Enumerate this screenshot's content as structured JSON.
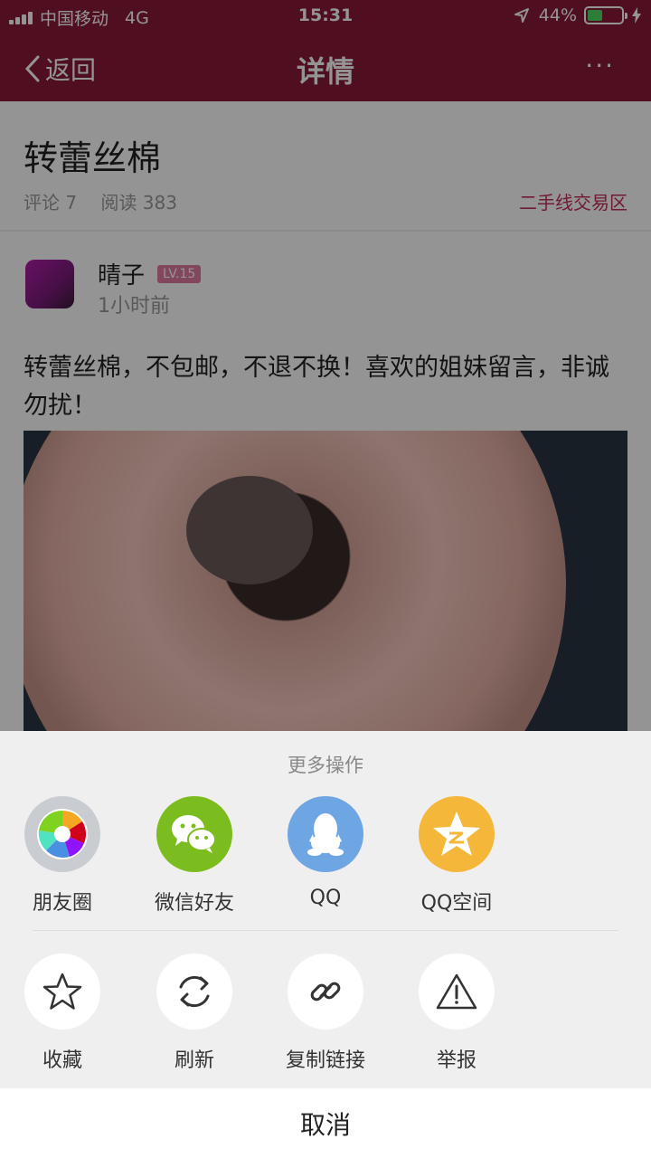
{
  "status_bar": {
    "carrier": "中国移动",
    "network": "4G",
    "time": "15:31",
    "battery": "44%",
    "battery_level": 0.44
  },
  "nav": {
    "back_label": "返回",
    "title": "详情",
    "more_label": "···"
  },
  "post": {
    "title": "转蕾丝棉",
    "comments": "评论 7",
    "reads": "阅读 383",
    "category": "二手线交易区",
    "author": "晴子",
    "level": "LV.15",
    "time_ago": "1小时前",
    "body": "转蕾丝棉，不包邮，不退不换！喜欢的姐妹留言，非诚勿扰！"
  },
  "sheet": {
    "title": "更多操作",
    "share": [
      {
        "label": "朋友圈",
        "icon": "moments-icon",
        "color": "#c9cdd1"
      },
      {
        "label": "微信好友",
        "icon": "wechat-icon",
        "color": "#7bbd1e"
      },
      {
        "label": "QQ",
        "icon": "qq-icon",
        "color": "#6ea6e3"
      },
      {
        "label": "QQ空间",
        "icon": "qzone-icon",
        "color": "#f4b73a"
      }
    ],
    "actions": [
      {
        "label": "收藏",
        "icon": "star-icon"
      },
      {
        "label": "刷新",
        "icon": "refresh-icon"
      },
      {
        "label": "复制链接",
        "icon": "link-icon"
      },
      {
        "label": "举报",
        "icon": "warning-icon"
      }
    ],
    "cancel_label": "取消"
  }
}
